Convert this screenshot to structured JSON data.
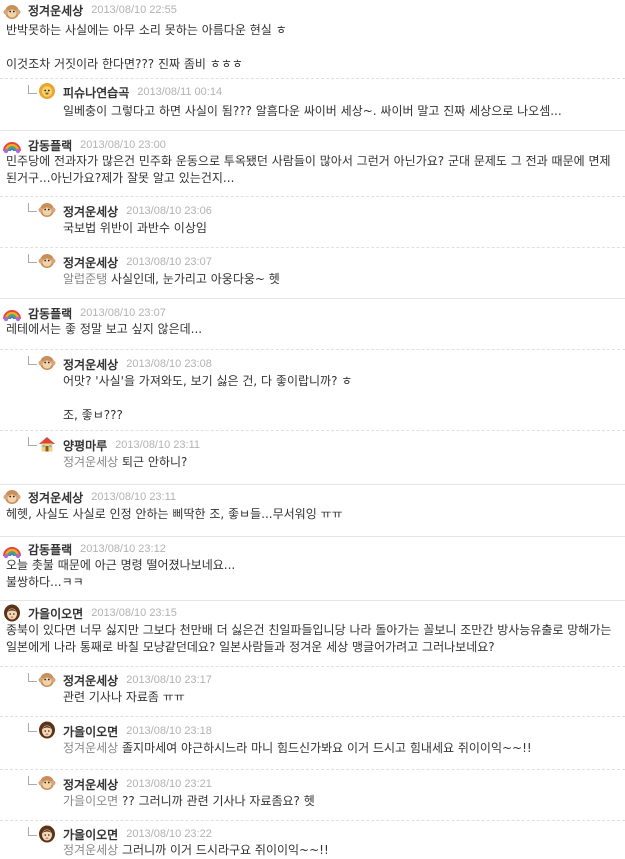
{
  "comments": [
    {
      "nick": "정겨운세상",
      "date": "2013/08/10 22:55",
      "text": "반박못하는 사실에는 아무 소리 못하는 아름다운 현실 ㅎ\n\n이것조차 거짓이라 한다면??? 진짜 좀비 ㅎㅎㅎ",
      "avatar": "monkey"
    },
    {
      "nick": "피슈나연습곡",
      "date": "2013/08/11 00:14",
      "text": "일베충이 그렇다고 하면 사실이 됨??? 알흠다운 싸이버 세상~. 싸이버 말고 진짜 세상으로 나오셈...",
      "avatar": "lion"
    },
    {
      "nick": "감동플랙",
      "date": "2013/08/10 23:00",
      "text": "민주당에 전과자가 많은건 민주화 운동으로 투옥됐던 사람들이 많아서 그런거 아닌가요? 군대 문제도 그 전과 때문에 면제된거구...아닌가요?제가 잘못 알고 있는건지...",
      "avatar": "rainbow"
    },
    {
      "nick": "정겨운세상",
      "date": "2013/08/10 23:06",
      "text": "국보법 위반이 과반수 이상임",
      "avatar": "monkey"
    },
    {
      "nick": "정겨운세상",
      "date": "2013/08/10 23:07",
      "mention": "알럽준탱",
      "text": " 사실인데, 눈가리고 아웅다웅~ 헷",
      "avatar": "monkey"
    },
    {
      "nick": "감동플랙",
      "date": "2013/08/10 23:07",
      "text": "레테에서는 좋 정말 보고 싶지 않은데...",
      "avatar": "rainbow"
    },
    {
      "nick": "정겨운세상",
      "date": "2013/08/10 23:08",
      "text": "어맛? '사실'을 가져와도, 보기 싫은 건, 다 좋이랍니까? ㅎ\n\n조, 좋ㅂ???",
      "avatar": "monkey"
    },
    {
      "nick": "양평마루",
      "date": "2013/08/10 23:11",
      "mention": "정겨운세상",
      "text": " 퇴근 안하니?",
      "avatar": "house"
    },
    {
      "nick": "정겨운세상",
      "date": "2013/08/10 23:11",
      "text": "헤헷, 사실도 사실로 인정 안하는 삐딱한 조, 좋ㅂ들...무서워잉 ㅠㅠ",
      "avatar": "monkey"
    },
    {
      "nick": "감동플랙",
      "date": "2013/08/10 23:12",
      "text": "오늘 촛불 때문에 아근 명령 떨어졌나보네요...\n불쌍하다...ㅋㅋ",
      "avatar": "rainbow"
    },
    {
      "nick": "가을이오면",
      "date": "2013/08/10 23:15",
      "text": "종북이 있다면 너무 싫지만 그보다 천만배 더 싫은건 친일파들입니당 나라 돌아가는 꼴보니 조만간 방사능유출로 망해가는 일본에게 나라 통째로 바칠 모냥같던데요? 일본사람들과 정겨운 세상 맹글어가려고 그러나보네요?",
      "avatar": "girl"
    },
    {
      "nick": "정겨운세상",
      "date": "2013/08/10 23:17",
      "text": "관련 기사나 자료좀 ㅠㅠ",
      "avatar": "monkey"
    },
    {
      "nick": "가을이오면",
      "date": "2013/08/10 23:18",
      "mention": "정겨운세상",
      "text": " 졸지마세여 야근하시느라 마니 힘드신가봐요 이거 드시고 힘내세요 쥐이이익~~!!",
      "avatar": "girl"
    },
    {
      "nick": "정겨운세상",
      "date": "2013/08/10 23:21",
      "mention": "가을이오면",
      "text": " ?? 그러니까 관련 기사나 자료좀요? 헷",
      "avatar": "monkey"
    },
    {
      "nick": "가을이오면",
      "date": "2013/08/10 23:22",
      "mention": "정겨운세상",
      "text": " 그러니까 이거 드시라구요 쥐이이익~~!!",
      "avatar": "girl"
    }
  ]
}
